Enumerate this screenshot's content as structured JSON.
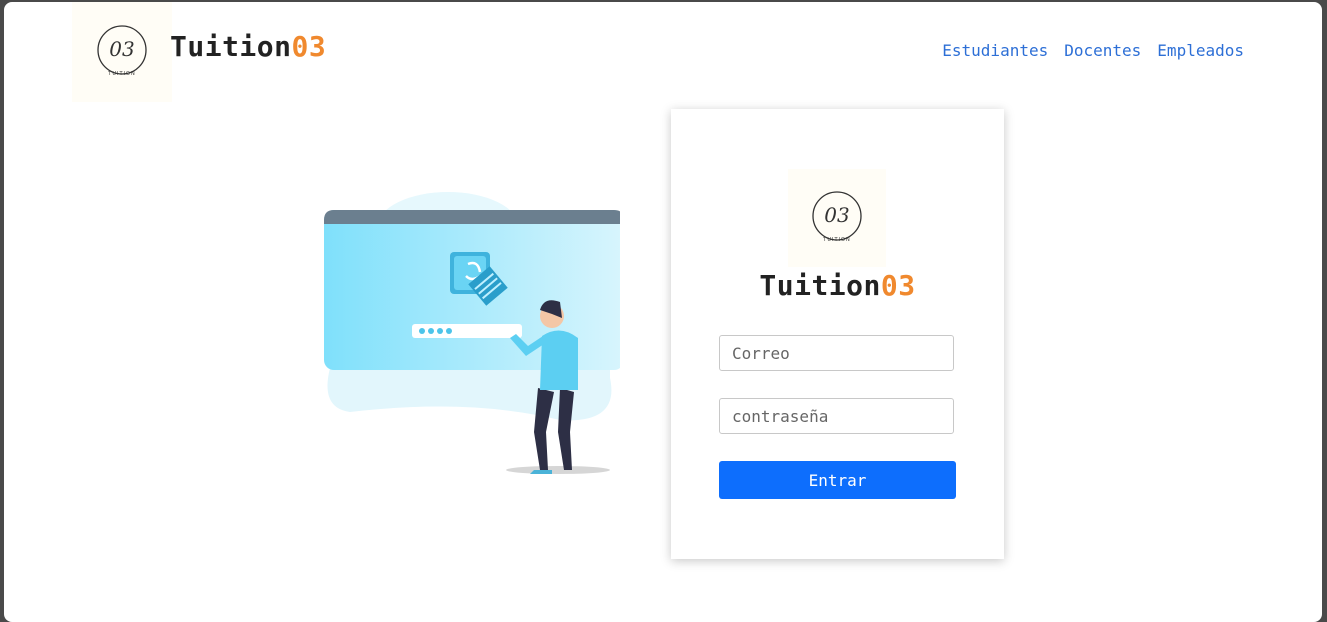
{
  "brand": {
    "name_main": "Tuition",
    "name_accent": "03",
    "logo_text": "03",
    "logo_sub": "TUITION"
  },
  "nav": {
    "items": [
      {
        "label": "Estudiantes"
      },
      {
        "label": "Docentes"
      },
      {
        "label": "Empleados"
      }
    ]
  },
  "login": {
    "title_main": "Tuition",
    "title_accent": "03",
    "email_placeholder": "Correo",
    "password_placeholder": "contraseña",
    "submit_label": "Entrar"
  },
  "colors": {
    "accent": "#f0892e",
    "link": "#2d6fd6",
    "button": "#0d6efd"
  }
}
